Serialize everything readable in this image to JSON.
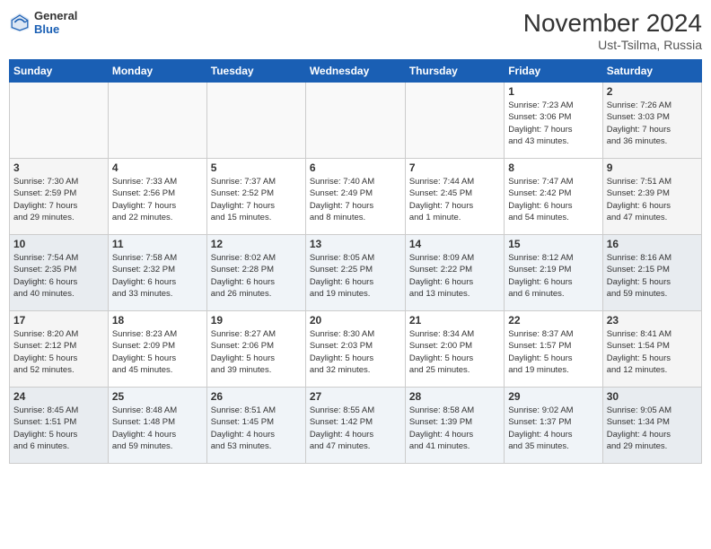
{
  "logo": {
    "general": "General",
    "blue": "Blue"
  },
  "header": {
    "month": "November 2024",
    "location": "Ust-Tsilma, Russia"
  },
  "weekdays": [
    "Sunday",
    "Monday",
    "Tuesday",
    "Wednesday",
    "Thursday",
    "Friday",
    "Saturday"
  ],
  "weeks": [
    [
      {
        "day": "",
        "info": ""
      },
      {
        "day": "",
        "info": ""
      },
      {
        "day": "",
        "info": ""
      },
      {
        "day": "",
        "info": ""
      },
      {
        "day": "",
        "info": ""
      },
      {
        "day": "1",
        "info": "Sunrise: 7:23 AM\nSunset: 3:06 PM\nDaylight: 7 hours\nand 43 minutes."
      },
      {
        "day": "2",
        "info": "Sunrise: 7:26 AM\nSunset: 3:03 PM\nDaylight: 7 hours\nand 36 minutes."
      }
    ],
    [
      {
        "day": "3",
        "info": "Sunrise: 7:30 AM\nSunset: 2:59 PM\nDaylight: 7 hours\nand 29 minutes."
      },
      {
        "day": "4",
        "info": "Sunrise: 7:33 AM\nSunset: 2:56 PM\nDaylight: 7 hours\nand 22 minutes."
      },
      {
        "day": "5",
        "info": "Sunrise: 7:37 AM\nSunset: 2:52 PM\nDaylight: 7 hours\nand 15 minutes."
      },
      {
        "day": "6",
        "info": "Sunrise: 7:40 AM\nSunset: 2:49 PM\nDaylight: 7 hours\nand 8 minutes."
      },
      {
        "day": "7",
        "info": "Sunrise: 7:44 AM\nSunset: 2:45 PM\nDaylight: 7 hours\nand 1 minute."
      },
      {
        "day": "8",
        "info": "Sunrise: 7:47 AM\nSunset: 2:42 PM\nDaylight: 6 hours\nand 54 minutes."
      },
      {
        "day": "9",
        "info": "Sunrise: 7:51 AM\nSunset: 2:39 PM\nDaylight: 6 hours\nand 47 minutes."
      }
    ],
    [
      {
        "day": "10",
        "info": "Sunrise: 7:54 AM\nSunset: 2:35 PM\nDaylight: 6 hours\nand 40 minutes."
      },
      {
        "day": "11",
        "info": "Sunrise: 7:58 AM\nSunset: 2:32 PM\nDaylight: 6 hours\nand 33 minutes."
      },
      {
        "day": "12",
        "info": "Sunrise: 8:02 AM\nSunset: 2:28 PM\nDaylight: 6 hours\nand 26 minutes."
      },
      {
        "day": "13",
        "info": "Sunrise: 8:05 AM\nSunset: 2:25 PM\nDaylight: 6 hours\nand 19 minutes."
      },
      {
        "day": "14",
        "info": "Sunrise: 8:09 AM\nSunset: 2:22 PM\nDaylight: 6 hours\nand 13 minutes."
      },
      {
        "day": "15",
        "info": "Sunrise: 8:12 AM\nSunset: 2:19 PM\nDaylight: 6 hours\nand 6 minutes."
      },
      {
        "day": "16",
        "info": "Sunrise: 8:16 AM\nSunset: 2:15 PM\nDaylight: 5 hours\nand 59 minutes."
      }
    ],
    [
      {
        "day": "17",
        "info": "Sunrise: 8:20 AM\nSunset: 2:12 PM\nDaylight: 5 hours\nand 52 minutes."
      },
      {
        "day": "18",
        "info": "Sunrise: 8:23 AM\nSunset: 2:09 PM\nDaylight: 5 hours\nand 45 minutes."
      },
      {
        "day": "19",
        "info": "Sunrise: 8:27 AM\nSunset: 2:06 PM\nDaylight: 5 hours\nand 39 minutes."
      },
      {
        "day": "20",
        "info": "Sunrise: 8:30 AM\nSunset: 2:03 PM\nDaylight: 5 hours\nand 32 minutes."
      },
      {
        "day": "21",
        "info": "Sunrise: 8:34 AM\nSunset: 2:00 PM\nDaylight: 5 hours\nand 25 minutes."
      },
      {
        "day": "22",
        "info": "Sunrise: 8:37 AM\nSunset: 1:57 PM\nDaylight: 5 hours\nand 19 minutes."
      },
      {
        "day": "23",
        "info": "Sunrise: 8:41 AM\nSunset: 1:54 PM\nDaylight: 5 hours\nand 12 minutes."
      }
    ],
    [
      {
        "day": "24",
        "info": "Sunrise: 8:45 AM\nSunset: 1:51 PM\nDaylight: 5 hours\nand 6 minutes."
      },
      {
        "day": "25",
        "info": "Sunrise: 8:48 AM\nSunset: 1:48 PM\nDaylight: 4 hours\nand 59 minutes."
      },
      {
        "day": "26",
        "info": "Sunrise: 8:51 AM\nSunset: 1:45 PM\nDaylight: 4 hours\nand 53 minutes."
      },
      {
        "day": "27",
        "info": "Sunrise: 8:55 AM\nSunset: 1:42 PM\nDaylight: 4 hours\nand 47 minutes."
      },
      {
        "day": "28",
        "info": "Sunrise: 8:58 AM\nSunset: 1:39 PM\nDaylight: 4 hours\nand 41 minutes."
      },
      {
        "day": "29",
        "info": "Sunrise: 9:02 AM\nSunset: 1:37 PM\nDaylight: 4 hours\nand 35 minutes."
      },
      {
        "day": "30",
        "info": "Sunrise: 9:05 AM\nSunset: 1:34 PM\nDaylight: 4 hours\nand 29 minutes."
      }
    ]
  ]
}
